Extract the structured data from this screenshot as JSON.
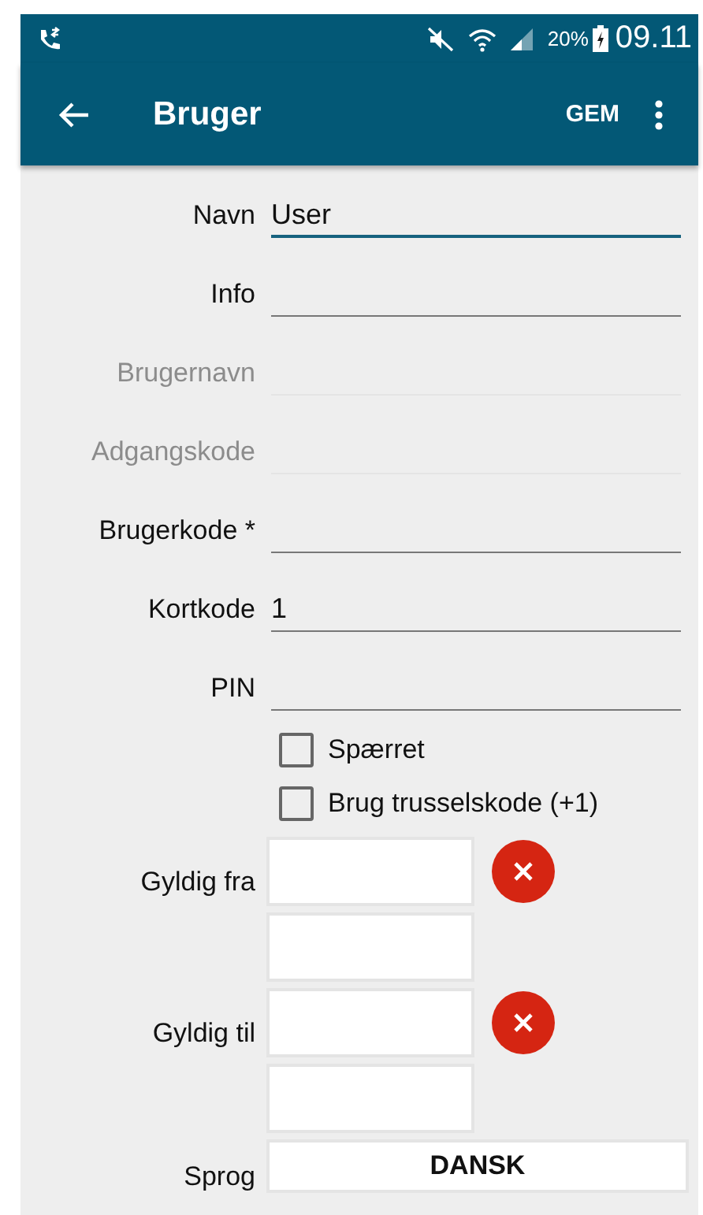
{
  "status_bar": {
    "battery": "20%",
    "time": "09.11"
  },
  "app_bar": {
    "title": "Bruger",
    "action": "GEM"
  },
  "fields": [
    {
      "label": "Navn",
      "value": "User",
      "focused": true,
      "disabled": false
    },
    {
      "label": "Info",
      "focused": false,
      "disabled": false
    },
    {
      "label": "Brugernavn",
      "focused": false,
      "disabled": true
    },
    {
      "label": "Adgangskode",
      "focused": false,
      "disabled": true
    },
    {
      "label": "Brugerkode *",
      "focused": false,
      "disabled": false
    },
    {
      "label": "Kortkode",
      "value": "1",
      "focused": false,
      "disabled": false
    },
    {
      "label": "PIN",
      "focused": false,
      "disabled": false
    }
  ],
  "checkboxes": [
    {
      "label": "Spærret",
      "checked": false
    },
    {
      "label": "Brug trusselskode (+1)",
      "checked": false
    }
  ],
  "date_ranges": [
    {
      "label": "Gyldig fra"
    },
    {
      "label": "Gyldig til"
    }
  ],
  "language": {
    "label": "Sprog",
    "value": "DANSK"
  }
}
